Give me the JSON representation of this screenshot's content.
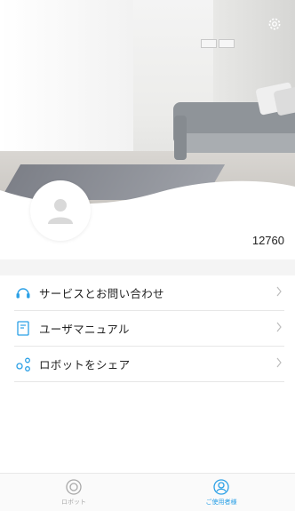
{
  "profile": {
    "user_id": "12760"
  },
  "menu": {
    "items": [
      {
        "label": "サービスとお問い合わせ",
        "icon": "headset-icon"
      },
      {
        "label": "ユーザマニュアル",
        "icon": "manual-icon"
      },
      {
        "label": "ロボットをシェア",
        "icon": "share-icon"
      }
    ]
  },
  "tabbar": {
    "tabs": [
      {
        "label": "ロボット",
        "icon": "robot-icon",
        "active": false
      },
      {
        "label": "ご使用者様",
        "icon": "user-icon",
        "active": true
      }
    ]
  },
  "colors": {
    "accent": "#2ba0e6",
    "inactive": "#a8a8a8",
    "text": "#222222",
    "divider": "#e6e6e6"
  }
}
